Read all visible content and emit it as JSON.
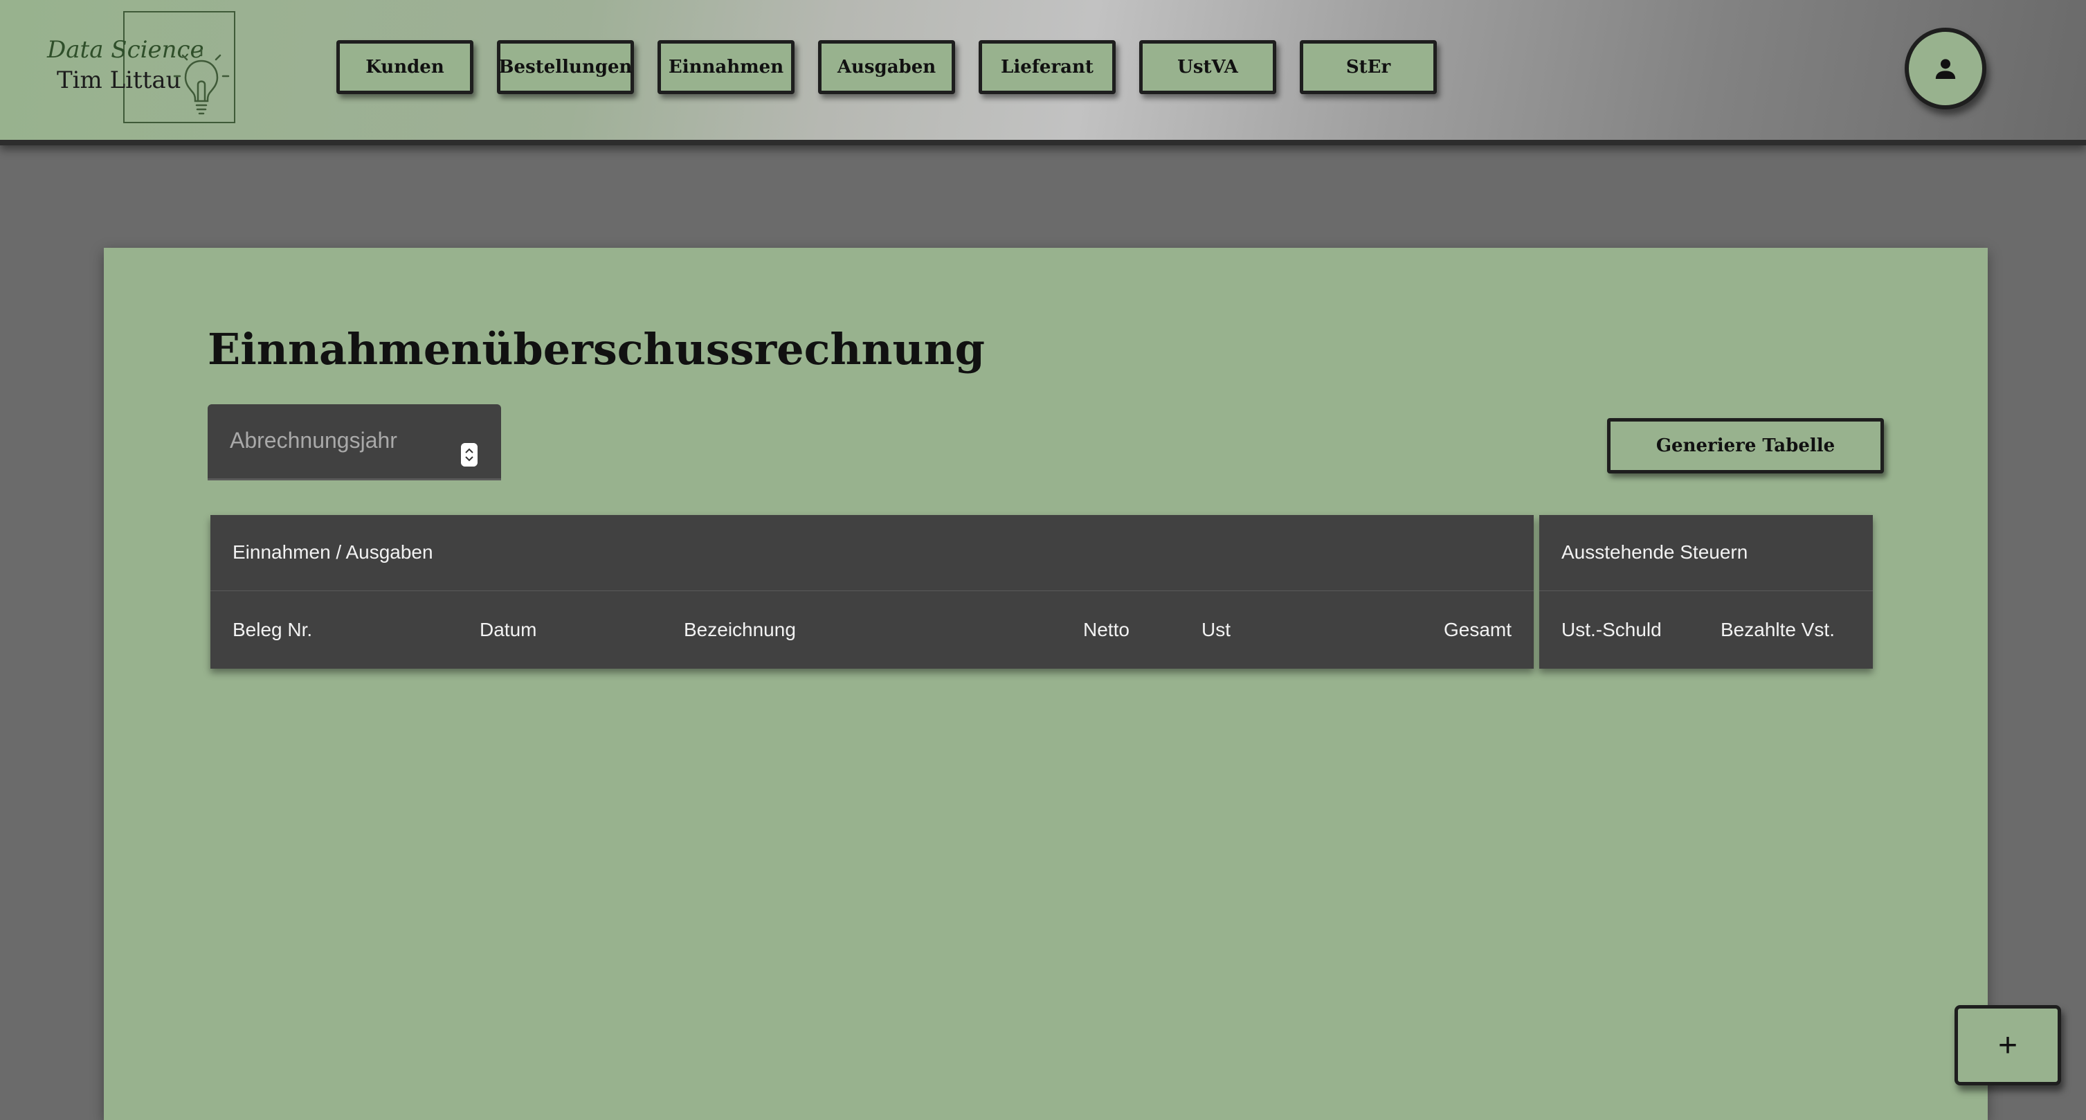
{
  "logo": {
    "line1": "Data Science",
    "line2": "Tim Littau",
    "icon": "lightbulb-icon"
  },
  "nav": {
    "items": [
      {
        "label": "Kunden"
      },
      {
        "label": "Bestellungen"
      },
      {
        "label": "Einnahmen"
      },
      {
        "label": "Ausgaben"
      },
      {
        "label": "Lieferant"
      },
      {
        "label": "UstVA"
      },
      {
        "label": "StEr"
      }
    ]
  },
  "account": {
    "icon": "person-icon"
  },
  "main": {
    "title": "Einnahmenüberschussrechnung",
    "year_select": {
      "placeholder": "Abrechnungsjahr",
      "icon": "stepper-icon"
    },
    "generate_button": "Generiere Tabelle",
    "table": {
      "group_main": "Einnahmen / Ausgaben",
      "group_tax": "Ausstehende Steuern",
      "columns_main": [
        "Beleg Nr.",
        "Datum",
        "Bezeichnung",
        "Netto",
        "Ust",
        "Gesamt"
      ],
      "columns_tax": [
        "Ust.-Schuld",
        "Bezahlte Vst."
      ],
      "rows": []
    }
  },
  "fab": {
    "label": "+"
  },
  "colors": {
    "accent_green": "#98b28e",
    "table_dark": "#414141",
    "background": "#6b6b6b",
    "border_dark": "#1e1e1e"
  }
}
